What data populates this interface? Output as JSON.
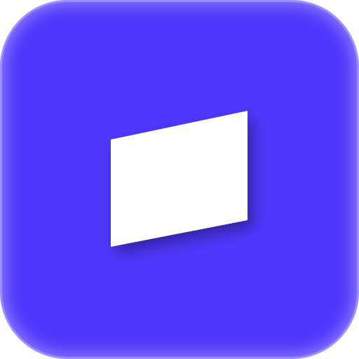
{
  "icon": {
    "name": "parallelogram-card-icon",
    "background_color": "#4f37fc",
    "glyph_color": "#ffffff",
    "edge_glow_color": "#bdb4ff"
  }
}
